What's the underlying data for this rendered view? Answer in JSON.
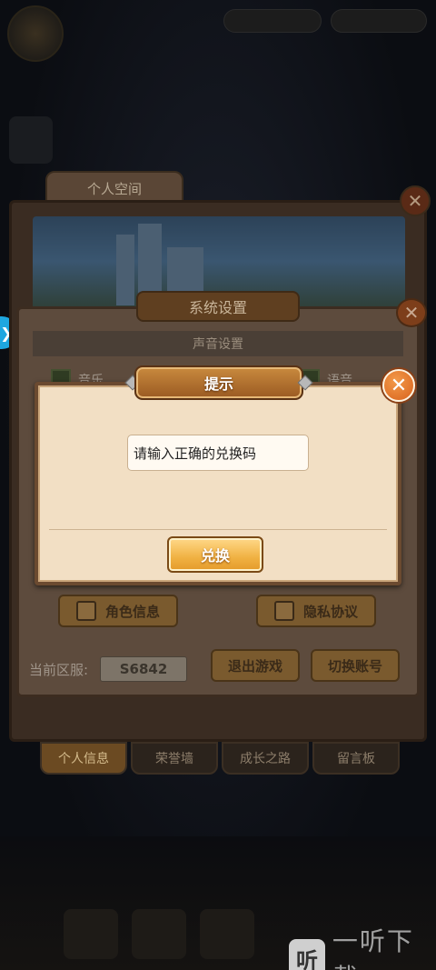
{
  "background": {
    "player_name": "",
    "player_subtitle": "",
    "personal_space_tab": "个人空间",
    "space_tabs": [
      {
        "label": "个人信息",
        "active": true
      },
      {
        "label": "荣誉墙",
        "active": false
      },
      {
        "label": "成长之路",
        "active": false
      },
      {
        "label": "留言板",
        "active": false
      }
    ]
  },
  "settings": {
    "title": "系统设置",
    "sound_section": "声音设置",
    "music_label": "音乐",
    "voice_label": "语音",
    "role_info_button": "角色信息",
    "privacy_button": "隐私协议",
    "server_label": "当前区服:",
    "server_value": "S6842",
    "exit_game_button": "退出游戏",
    "switch_account_button": "切换账号"
  },
  "prompt": {
    "title": "提示",
    "input_value": "请输入正确的兑换码",
    "redeem_button": "兑换",
    "close_symbol": "✕"
  },
  "watermark": {
    "logo_char": "听",
    "text": "一听下载"
  },
  "colors": {
    "accent_orange": "#f0b142",
    "dialog_bg": "#f2dfc4",
    "close_orange": "#e0702a",
    "side_arrow_blue": "#1ea7e0"
  }
}
